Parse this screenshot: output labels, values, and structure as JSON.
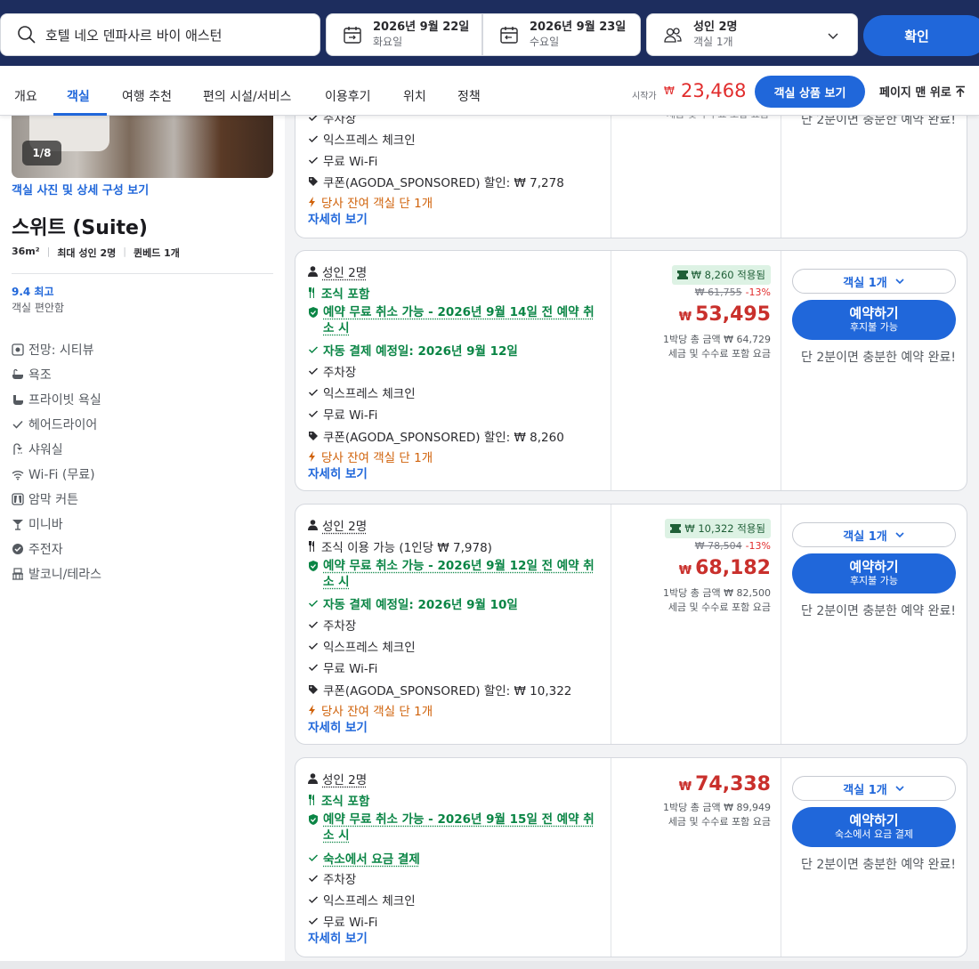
{
  "search": {
    "hotel": "호텔 네오 덴파사르 바이 애스턴",
    "checkin_date": "2026년 9월 22일",
    "checkin_day": "화요일",
    "checkout_date": "2026년 9월 23일",
    "checkout_day": "수요일",
    "guests": "성인 2명",
    "rooms": "객실 1개",
    "confirm_label": "확인"
  },
  "nav": {
    "tabs": [
      "개요",
      "객실",
      "여행 추천",
      "편의 시설/서비스",
      "이용후기",
      "위치",
      "정책"
    ],
    "active_tab": "객실",
    "from_label": "시작가",
    "currency": "₩",
    "from_price": "23,468",
    "view_rooms_label": "객실 상품 보기",
    "back_to_top_label": "페이지 맨 위로"
  },
  "room": {
    "photo_counter": "1/8",
    "photo_link": "객실 사진 및 상세 구성 보기",
    "name": "스위트 (Suite)",
    "size": "36m²",
    "max_guests": "최대 성인 2명",
    "bed": "퀸베드 1개",
    "score": "9.4 최고",
    "score_sub": "객실 편안함",
    "amenities": [
      {
        "icon": "view-icon",
        "label": "전망: 시티뷰"
      },
      {
        "icon": "bathtub-icon",
        "label": "욕조"
      },
      {
        "icon": "private-bath-icon",
        "label": "프라이빗 욕실"
      },
      {
        "icon": "check-icon",
        "label": "헤어드라이어"
      },
      {
        "icon": "shower-icon",
        "label": "샤워실"
      },
      {
        "icon": "wifi-icon",
        "label": "Wi-Fi (무료)"
      },
      {
        "icon": "curtain-icon",
        "label": "암막 커튼"
      },
      {
        "icon": "minibar-icon",
        "label": "미니바"
      },
      {
        "icon": "bicycle-icon",
        "label": "주전자"
      },
      {
        "icon": "balcony-icon",
        "label": "발코니/테라스"
      }
    ]
  },
  "card0": {
    "top_row": "주차장",
    "express": "익스프레스 체크인",
    "wifi": "무료 Wi-Fi",
    "coupon": "쿠폰(AGODA_SPONSORED) 할인: ₩ 7,278",
    "scarcity": "당사 잔여 객실 단 1개",
    "details": "자세히 보기",
    "top_price_note": "세금 및 수수료 포함 요금",
    "hint": "단 2분이면 충분한 예약 완료!"
  },
  "offers": [
    {
      "guests": "성인 2명",
      "meal": "조식 포함",
      "cancel": "예약 무료 취소 가능 - 2026년 9월 14일 전 예약 취소 시",
      "payment": "자동 결제 예정일: 2026년 9월 12일",
      "parking": "주차장",
      "express": "익스프레스 체크인",
      "wifi": "무료 Wi-Fi",
      "coupon": "쿠폰(AGODA_SPONSORED) 할인: ₩ 8,260",
      "scarcity": "당사 잔여 객실 단 1개",
      "details": "자세히 보기",
      "coupon_applied": "₩ 8,260 적용됨",
      "original_price": "₩ 61,755",
      "discount": "-13%",
      "currency": "₩",
      "price": "53,495",
      "per_night": "1박당 총 금액 ₩ 64,729",
      "tax_note": "세금 및 수수료 포함 요금",
      "room_select": "객실 1개",
      "book_label": "예약하기",
      "book_sub": "후지불 가능",
      "hint": "단 2분이면 충분한 예약 완료!"
    },
    {
      "guests": "성인 2명",
      "meal": "조식 이용 가능 (1인당 ₩ 7,978)",
      "cancel": "예약 무료 취소 가능 - 2026년 9월 12일 전 예약 취소 시",
      "payment": "자동 결제 예정일: 2026년 9월 10일",
      "parking": "주차장",
      "express": "익스프레스 체크인",
      "wifi": "무료 Wi-Fi",
      "coupon": "쿠폰(AGODA_SPONSORED) 할인: ₩ 10,322",
      "scarcity": "당사 잔여 객실 단 1개",
      "details": "자세히 보기",
      "coupon_applied": "₩ 10,322 적용됨",
      "original_price": "₩ 78,504",
      "discount": "-13%",
      "currency": "₩",
      "price": "68,182",
      "per_night": "1박당 총 금액 ₩ 82,500",
      "tax_note": "세금 및 수수료 포함 요금",
      "room_select": "객실 1개",
      "book_label": "예약하기",
      "book_sub": "후지불 가능",
      "hint": "단 2분이면 충분한 예약 완료!"
    },
    {
      "guests": "성인 2명",
      "meal": "조식 포함",
      "cancel": "예약 무료 취소 가능 - 2026년 9월 15일 전 예약 취소 시",
      "payment": "숙소에서 요금 결제",
      "parking": "주차장",
      "express": "익스프레스 체크인",
      "wifi": "무료 Wi-Fi",
      "details": "자세히 보기",
      "currency": "₩",
      "price": "74,338",
      "per_night": "1박당 총 금액 ₩ 89,949",
      "tax_note": "세금 및 수수료 포함 요금",
      "room_select": "객실 1개",
      "book_label": "예약하기",
      "book_sub": "숙소에서 요금 결제",
      "hint": "단 2분이면 충분한 예약 완료!"
    }
  ],
  "colors": {
    "brand_navy": "#1d2d5e",
    "accent_blue": "#2067da",
    "price_red": "#c9302c",
    "green": "#0a8545",
    "orange": "#d0620a"
  }
}
